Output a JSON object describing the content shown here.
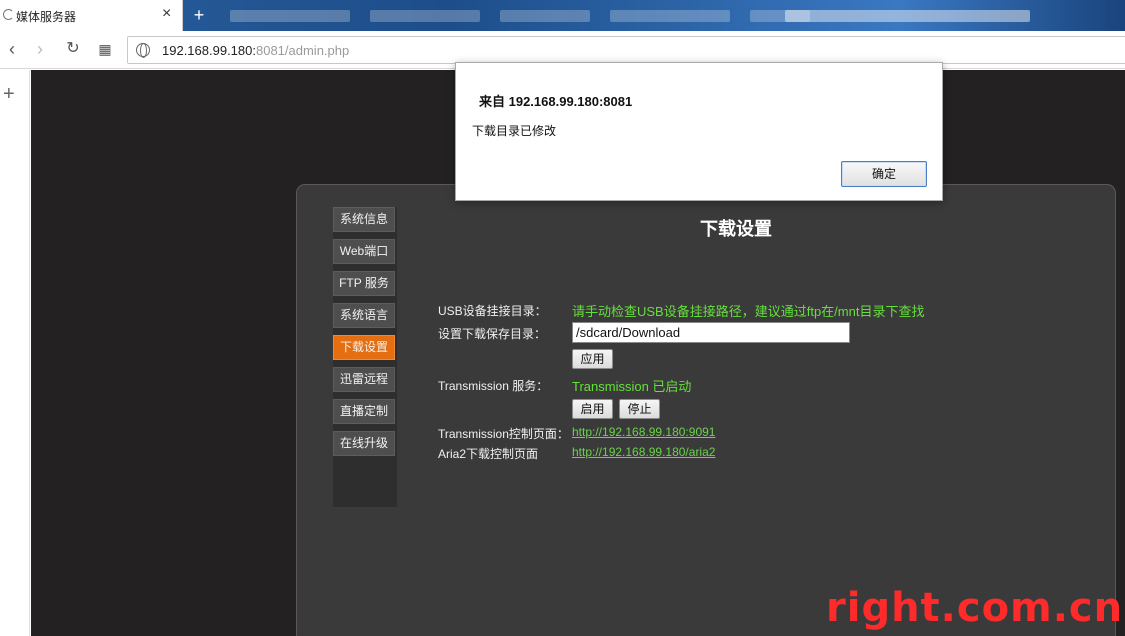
{
  "browser": {
    "tab_title": "媒体服务器",
    "address_host": "192.168.99.180:",
    "address_rest": "8081/admin.php"
  },
  "sidebar_menu": [
    {
      "label": "系统信息"
    },
    {
      "label": "Web端口"
    },
    {
      "label": "FTP 服务"
    },
    {
      "label": "系统语言"
    },
    {
      "label": "下载设置"
    },
    {
      "label": "迅雷远程"
    },
    {
      "label": "直播定制"
    },
    {
      "label": "在线升级"
    }
  ],
  "main": {
    "title": "下载设置",
    "usb_label": "USB设备挂接目录：",
    "usb_hint": "请手动检查USB设备挂接路径，建议通过ftp在/mnt目录下查找",
    "save_dir_label": "设置下载保存目录：",
    "save_dir_value": "/sdcard/Download",
    "apply_label": "应用",
    "transmission_label": "Transmission 服务：",
    "transmission_status": "Transmission 已启动",
    "start_label": "启用",
    "stop_label": "停止",
    "transmission_page_label": "Transmission控制页面：",
    "transmission_page_url": "http://192.168.99.180:9091",
    "aria2_label": "Aria2下载控制页面",
    "aria2_url": "http://192.168.99.180/aria2"
  },
  "dialog": {
    "title": "来自 192.168.99.180:8081",
    "message": "下载目录已修改",
    "ok_label": "确定"
  },
  "watermark": "right.com.cn",
  "colors": {
    "active_menu": "#e46e10",
    "status_green": "#64e03a",
    "panel_bg": "#3b3a3b",
    "page_bg": "#232122"
  }
}
